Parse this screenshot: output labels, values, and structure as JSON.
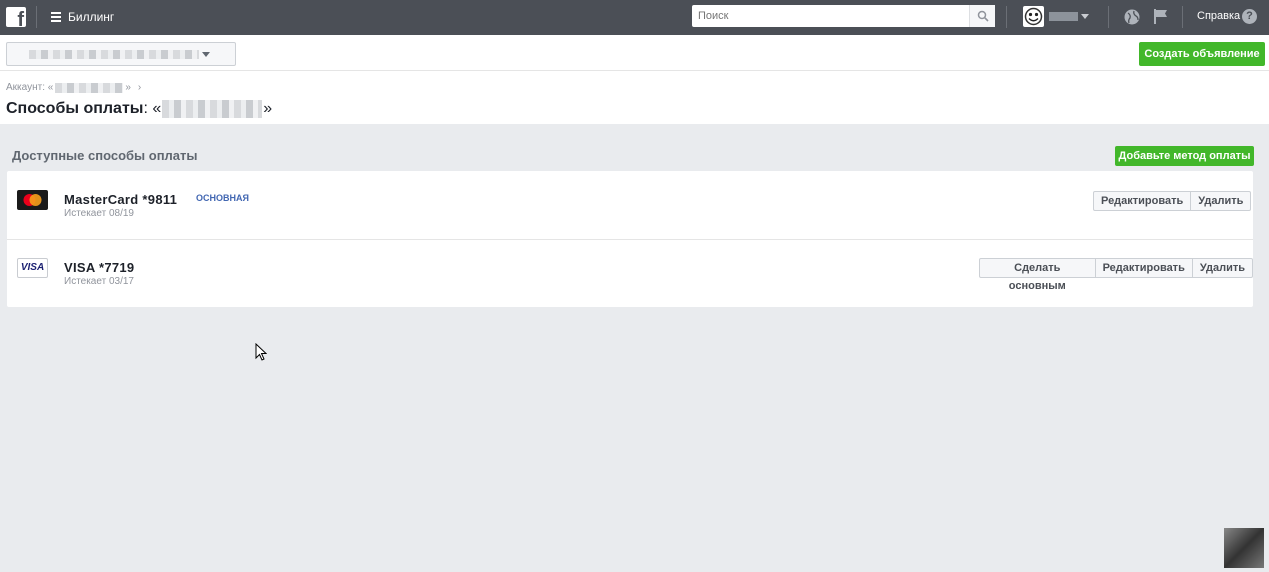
{
  "topbar": {
    "logo": "f",
    "app_title": "Биллинг",
    "search_placeholder": "Поиск",
    "help_label": "Справка",
    "help_icon": "?"
  },
  "subbar": {
    "create_ad_label": "Создать объявление"
  },
  "breadcrumb": {
    "prefix": "Аккаунт: «",
    "suffix": "»",
    "chevron": "›"
  },
  "page": {
    "title": "Способы оплаты",
    "title_sep": ": «",
    "title_end": "»"
  },
  "section": {
    "title": "Доступные способы оплаты",
    "add_label": "Добавьте метод оплаты"
  },
  "cards": [
    {
      "icon": "mastercard-icon",
      "name": "MasterCard *9811",
      "expires": "Истекает 08/19",
      "badge": "ОСНОВНАЯ",
      "actions": [
        "Редактировать",
        "Удалить"
      ]
    },
    {
      "icon": "visa-icon",
      "icon_text": "VISA",
      "name": "VISA *7719",
      "expires": "Истекает 03/17",
      "actions": [
        "Сделать основным",
        "Редактировать",
        "Удалить"
      ]
    }
  ],
  "colors": {
    "topbar": "#4b4f56",
    "green": "#42b72a",
    "badge": "#4267b2",
    "background": "#e9ebee"
  }
}
